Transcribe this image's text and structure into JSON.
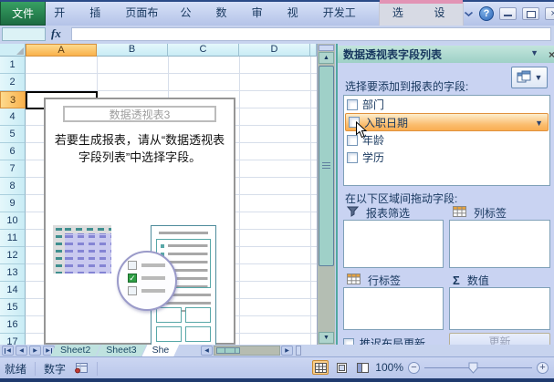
{
  "colors": {
    "file_tab_green": "#1e7145",
    "contextual_pink": "#e294b5",
    "header_selection_orange": "#f9b14b",
    "pane_titlebar_teal": "#a9d6cd",
    "pane_background": "#c9d3f2",
    "field_highlight_orange": "#fbbd6e",
    "scrollbar_teal": "#9fd0c8",
    "status_bar_lavender": "#c0cdee"
  },
  "ribbon": {
    "tabs": [
      {
        "label": "文件"
      },
      {
        "label": "开始"
      },
      {
        "label": "插入"
      },
      {
        "label": "页面布局"
      },
      {
        "label": "公式"
      },
      {
        "label": "数据"
      },
      {
        "label": "审阅"
      },
      {
        "label": "视图"
      },
      {
        "label": "开发工具"
      }
    ],
    "contextual_tabs": [
      {
        "label": "选项"
      },
      {
        "label": "设计"
      }
    ],
    "help_label": "?"
  },
  "formula_bar": {
    "fx_label": "fx",
    "name_box_value": "",
    "formula_value": ""
  },
  "worksheet": {
    "column_headers": [
      "A",
      "B",
      "C",
      "D"
    ],
    "row_headers": [
      "1",
      "2",
      "3",
      "4",
      "5",
      "6",
      "7",
      "8",
      "9",
      "10",
      "11",
      "12",
      "13",
      "14",
      "15",
      "16",
      "17"
    ],
    "selected_column": "A",
    "selected_row": "3",
    "active_cell": "A3",
    "placeholder": {
      "title": "数据透视表3",
      "instruction_line1": "若要生成报表，请从“数据透视表",
      "instruction_line2": "字段列表”中选择字段。",
      "check_glyph": "✓"
    }
  },
  "field_pane": {
    "title": "数据透视表字段列表",
    "choose_fields_label": "选择要添加到报表的字段:",
    "fields": [
      {
        "label": "部门",
        "checked": false,
        "highlighted": false
      },
      {
        "label": "入职日期",
        "checked": false,
        "highlighted": true
      },
      {
        "label": "年龄",
        "checked": false,
        "highlighted": false
      },
      {
        "label": "学历",
        "checked": false,
        "highlighted": false
      }
    ],
    "drag_areas_label": "在以下区域间拖动字段:",
    "areas": {
      "report_filter": "报表筛选",
      "column_labels": "列标签",
      "row_labels": "行标签",
      "values": "数值",
      "sigma": "Σ"
    },
    "defer_layout_label": "推迟布局更新",
    "update_button_label": "更新"
  },
  "sheet_bar": {
    "tabs": [
      {
        "label": "Sheet2",
        "active": false
      },
      {
        "label": "Sheet3",
        "active": false
      },
      {
        "label": "She",
        "active": true
      }
    ]
  },
  "status_bar": {
    "ready_label": "就绪",
    "numlock_label": "数字",
    "zoom_level": "100%"
  },
  "icons": {
    "dropdown": "▼",
    "close": "×",
    "up": "▲",
    "down": "▼",
    "left": "◀",
    "right": "▶",
    "minus": "−",
    "plus": "+"
  }
}
